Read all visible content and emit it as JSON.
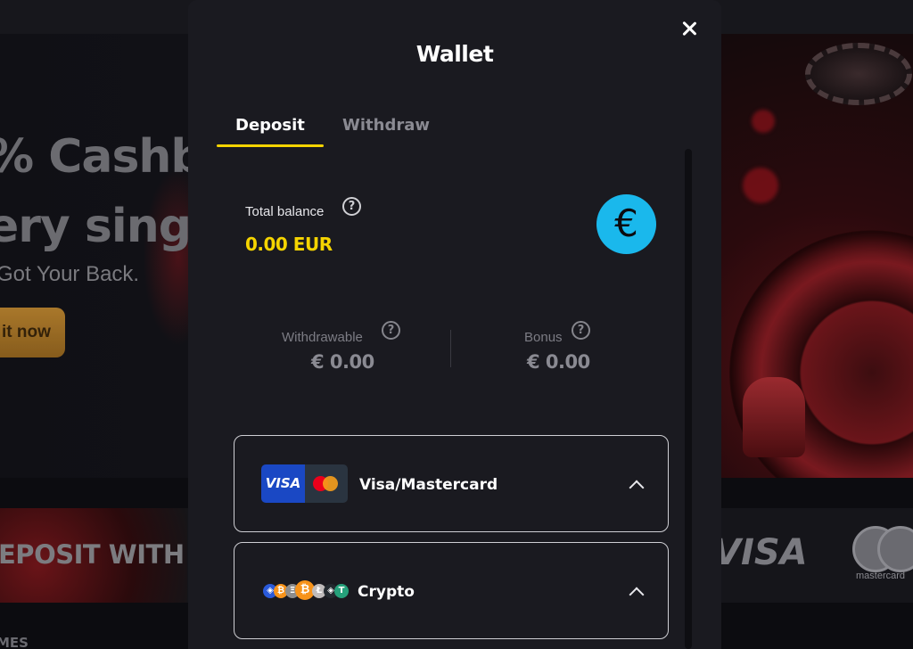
{
  "background": {
    "hero_title_line1": "% Cashb",
    "hero_title_line2": "ery singl",
    "hero_subtitle": "Got Your Back.",
    "hero_button": "it now",
    "promo_strip_text": "EPOSIT WITH S",
    "strip_visa_text": "VISA",
    "strip_mastercard_text": "mastercard",
    "games_label": "MES"
  },
  "wallet": {
    "title": "Wallet",
    "tabs": [
      {
        "label": "Deposit",
        "active": true
      },
      {
        "label": "Withdraw",
        "active": false
      }
    ],
    "balance": {
      "label": "Total balance",
      "value": "0.00 EUR",
      "currency_symbol": "€",
      "help_glyph": "?"
    },
    "sub_balances": [
      {
        "label": "Withdrawable",
        "value": "€ 0.00"
      },
      {
        "label": "Bonus",
        "value": "€ 0.00"
      }
    ],
    "payment_methods": [
      {
        "name": "Visa/Mastercard",
        "logo_text": "VISA",
        "expanded": true
      },
      {
        "name": "Crypto",
        "expanded": true
      }
    ],
    "crypto_coins": [
      "₿",
      "Ł",
      "Ξ",
      "◈",
      "T"
    ],
    "colors": {
      "accent_yellow": "#f5d400",
      "euro_badge": "#1ab8ec",
      "modal_bg": "#1a1a20",
      "visa_blue": "#1a48c4"
    }
  }
}
